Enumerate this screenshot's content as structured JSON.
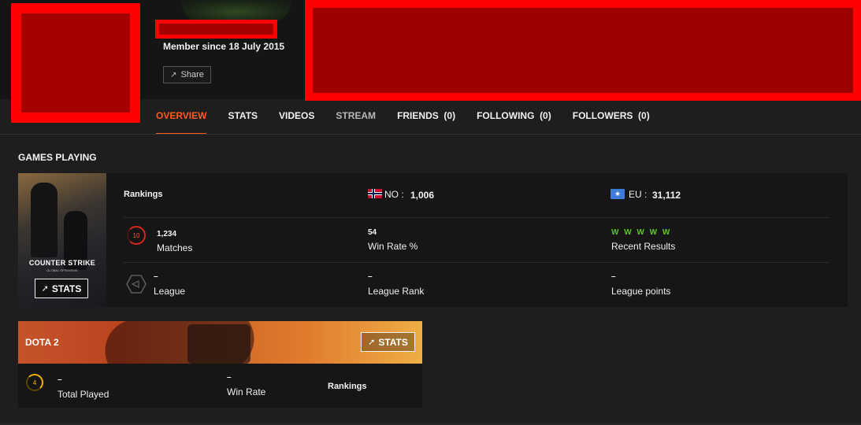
{
  "profile": {
    "member_since": "Member since 18 July 2015",
    "share_label": "Share"
  },
  "tabs": [
    {
      "label": "OVERVIEW"
    },
    {
      "label": "STATS"
    },
    {
      "label": "VIDEOS"
    },
    {
      "label": "STREAM"
    },
    {
      "label": "FRIENDS  (0)"
    },
    {
      "label": "FOLLOWING  (0)"
    },
    {
      "label": "FOLLOWERS  (0)"
    }
  ],
  "games_section_title": "GAMES PLAYING",
  "csgo": {
    "cover_logo": "COUNTER STRIKE",
    "cover_subtitle": "GLOBAL OFFENSIVE",
    "stats_label": "STATS",
    "rankings_label": "Rankings",
    "rank_no_label": "NO :",
    "rank_no_value": "1,006",
    "rank_eu_label": "EU :",
    "rank_eu_value": "31,112",
    "level": "10",
    "matches_value": "1,234",
    "matches_label": "Matches",
    "winrate_value": "54",
    "winrate_label": "Win Rate %",
    "recent_results": "W W W W W",
    "recent_results_label": "Recent Results",
    "league_value": "–",
    "league_label": "League",
    "league_rank_value": "–",
    "league_rank_label": "League Rank",
    "league_points_value": "–",
    "league_points_label": "League points"
  },
  "dota": {
    "title": "DOTA 2",
    "stats_label": "STATS",
    "played_badge": "4",
    "total_played_value": "–",
    "total_played_label": "Total Played",
    "winrate_value": "–",
    "winrate_label": "Win Rate",
    "rankings_label": "Rankings"
  },
  "colors": {
    "accent": "#ff5a1f",
    "win": "#5fc22e",
    "redaction": "#ff0000"
  }
}
